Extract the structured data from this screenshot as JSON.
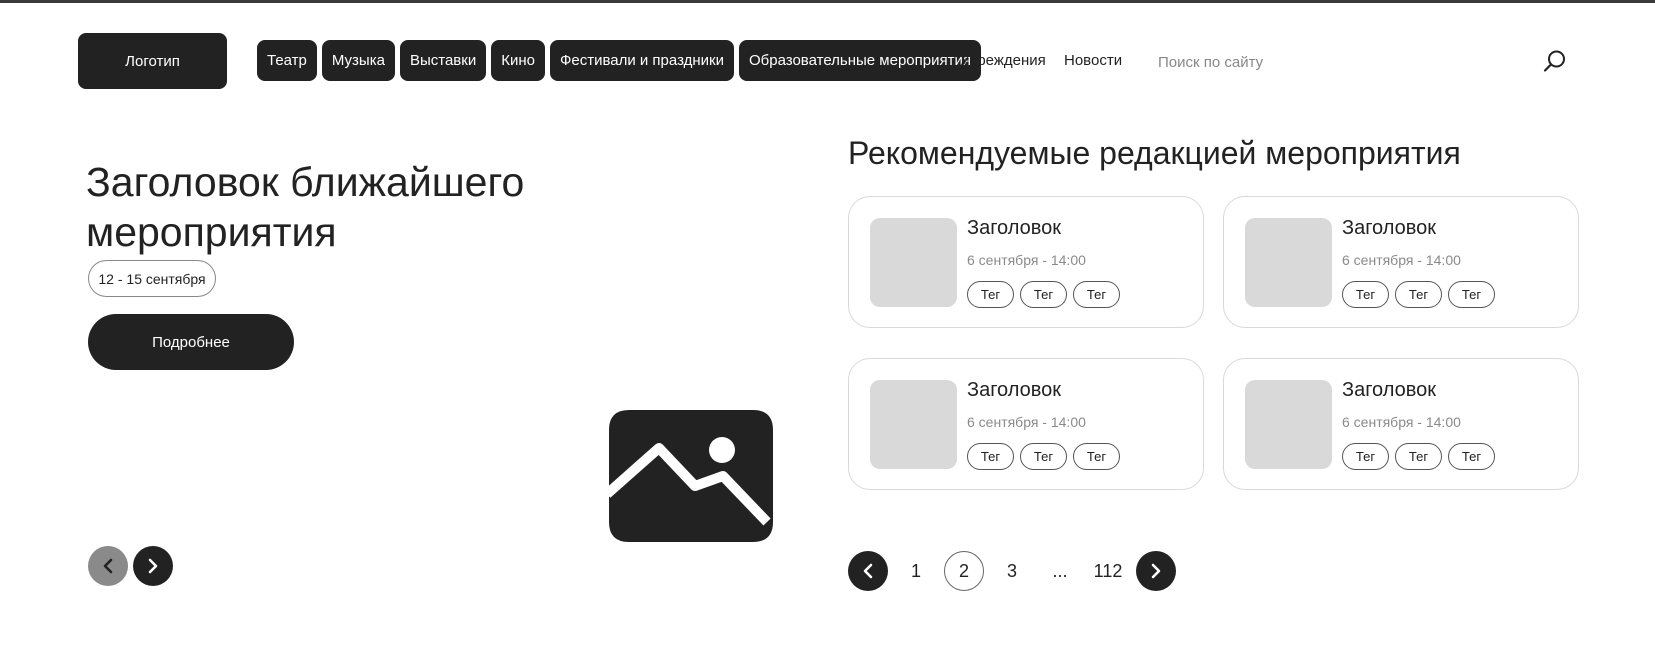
{
  "header": {
    "logo": "Логотип",
    "categories": [
      "Театр",
      "Музыка",
      "Выставки",
      "Кино",
      "Фестивали и праздники",
      "Образовательные мероприятия"
    ],
    "links": [
      "Учреждения",
      "Новости"
    ],
    "search_placeholder": "Поиск по сайту"
  },
  "hero": {
    "title": "Заголовок ближайшего мероприятия",
    "date": "12 - 15 сентября",
    "button": "Подробнее"
  },
  "recommended": {
    "title": "Рекомендуемые редакцией мероприятия",
    "cards": [
      {
        "title": "Заголовок",
        "date": "6 сентября - 14:00",
        "tags": [
          "Тег",
          "Тег",
          "Тег"
        ]
      },
      {
        "title": "Заголовок",
        "date": "6 сентября - 14:00",
        "tags": [
          "Тег",
          "Тег",
          "Тег"
        ]
      },
      {
        "title": "Заголовок",
        "date": "6 сентября - 14:00",
        "tags": [
          "Тег",
          "Тег",
          "Тег"
        ]
      },
      {
        "title": "Заголовок",
        "date": "6 сентября - 14:00",
        "tags": [
          "Тег",
          "Тег",
          "Тег"
        ]
      }
    ]
  },
  "pagination": {
    "pages": [
      "1",
      "2",
      "3"
    ],
    "active": "2",
    "ellipsis": "...",
    "last": "112"
  },
  "colors": {
    "primary": "#222222",
    "disabled": "#8a8a8a",
    "placeholder": "#d9d9d9",
    "border": "#d9d9d9"
  },
  "icons": [
    "search-icon",
    "chevron-left-icon",
    "chevron-right-icon",
    "image-placeholder-icon"
  ]
}
